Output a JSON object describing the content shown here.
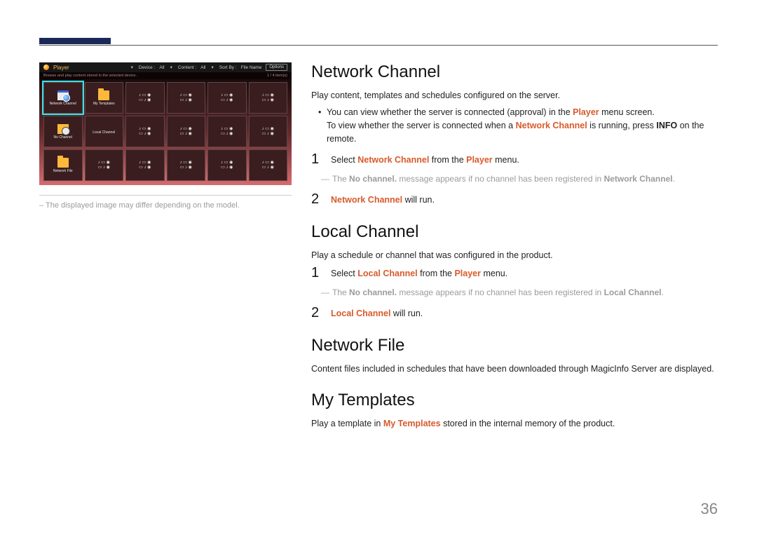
{
  "page_number": "36",
  "left": {
    "player_title": "Player",
    "device_label": "Device :",
    "device_value": "All",
    "content_label": "Content :",
    "content_value": "All",
    "sort_label": "Sort By :",
    "sort_value": "File Name",
    "options_btn": "Options",
    "browse_text": "Browse and play content stored in the selected device.",
    "count_text": "1 / 4 item(s)",
    "tiles": [
      {
        "label": "Network Channel",
        "kind": "calendar",
        "selected": true
      },
      {
        "label": "My Templates",
        "kind": "folder"
      },
      {
        "label": "",
        "kind": "media"
      },
      {
        "label": "",
        "kind": "media"
      },
      {
        "label": "",
        "kind": "media"
      },
      {
        "label": "",
        "kind": "media"
      },
      {
        "label": "No Channel",
        "kind": "clock"
      },
      {
        "label": "Local Channel",
        "kind": "label-only"
      },
      {
        "label": "",
        "kind": "media"
      },
      {
        "label": "",
        "kind": "media"
      },
      {
        "label": "",
        "kind": "media"
      },
      {
        "label": "",
        "kind": "media"
      },
      {
        "label": "Network File",
        "kind": "folder"
      },
      {
        "label": "",
        "kind": "media"
      },
      {
        "label": "",
        "kind": "media"
      },
      {
        "label": "",
        "kind": "media"
      },
      {
        "label": "",
        "kind": "media"
      },
      {
        "label": "",
        "kind": "media"
      }
    ],
    "footnote_prefix": "– ",
    "footnote": "The displayed image may differ depending on the model."
  },
  "sections": {
    "nc": {
      "heading": "Network Channel",
      "intro": "Play content, templates and schedules configured on the server.",
      "bullet_a": "You can view whether the server is connected (approval) in the ",
      "bullet_a_term": "Player",
      "bullet_a_tail": " menu screen.",
      "bullet_b_head": "To view whether the server is connected when a ",
      "bullet_b_term": "Network Channel",
      "bullet_b_mid": " is running, press ",
      "bullet_b_bold": "INFO",
      "bullet_b_tail": " on the remote.",
      "step1_a": "Select ",
      "step1_term1": "Network Channel",
      "step1_b": " from the ",
      "step1_term2": "Player",
      "step1_c": " menu.",
      "note_a": "The ",
      "note_bold": "No channel.",
      "note_b": " message appears if no channel has been registered in ",
      "note_term": "Network Channel",
      "note_tail": ".",
      "step2_term": "Network Channel",
      "step2_tail": " will run."
    },
    "lc": {
      "heading": "Local Channel",
      "intro": "Play a schedule or channel that was configured in the product.",
      "step1_a": "Select ",
      "step1_term1": "Local Channel",
      "step1_b": " from the ",
      "step1_term2": "Player",
      "step1_c": " menu.",
      "note_a": "The ",
      "note_bold": "No channel.",
      "note_b": " message appears if no channel has been registered in ",
      "note_term": "Local Channel",
      "note_tail": ".",
      "step2_term": "Local Channel",
      "step2_tail": " will run."
    },
    "nf": {
      "heading": "Network File",
      "intro": "Content files included in schedules that have been downloaded through MagicInfo Server are displayed."
    },
    "mt": {
      "heading": "My Templates",
      "intro_a": "Play a template in ",
      "intro_term": "My Templates",
      "intro_b": " stored in the internal memory of the product."
    }
  }
}
